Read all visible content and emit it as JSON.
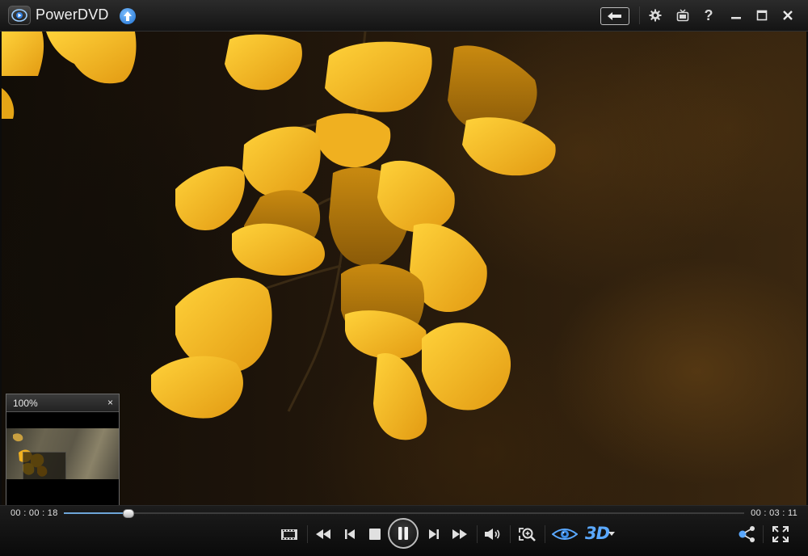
{
  "app": {
    "title": "PowerDVD"
  },
  "colors": {
    "accent": "#5aa8ff",
    "seek_fill": "#6ea6d8",
    "leaf": "#f2b81f",
    "leaf_shadow": "#c98a10"
  },
  "titlebar": {
    "icons": [
      "back-arrow-icon",
      "gear-icon",
      "tv-icon",
      "help-icon",
      "minimize-icon",
      "maximize-icon",
      "close-icon"
    ],
    "help_label": "?"
  },
  "preview": {
    "zoom": "100%",
    "close": "×"
  },
  "playback": {
    "current_time": "00 : 00 : 18",
    "total_time": "00 : 03 : 11",
    "progress": 0.094
  },
  "controls": {
    "label_3d": "3D",
    "icons": [
      "snapshot-icon",
      "rewind-icon",
      "previous-icon",
      "stop-icon",
      "pause-icon",
      "next-icon",
      "fast-forward-icon",
      "volume-icon",
      "zoom-icon",
      "eye-trueview-icon",
      "3d-dropdown-icon",
      "share-icon",
      "fullscreen-icon"
    ]
  }
}
